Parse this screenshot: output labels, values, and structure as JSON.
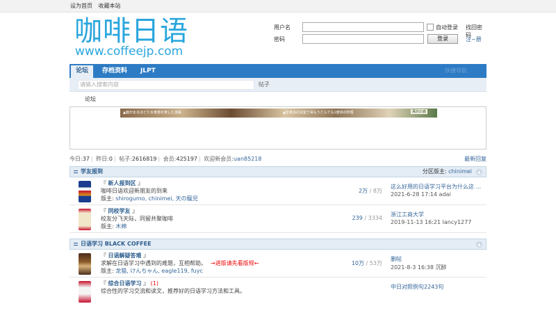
{
  "topbar": {
    "links": [
      "设为首页",
      "收藏本站"
    ]
  },
  "logo": {
    "cn": "咖啡日语",
    "en": "www.coffeejp.com"
  },
  "login": {
    "username_label": "用户名",
    "password_label": "密码",
    "auto_login_label": "自动登录",
    "find_password": "找回密码",
    "login_button": "登录",
    "register": "注~册"
  },
  "nav": {
    "tabs": [
      "论坛",
      "存档资料",
      "JLPT"
    ],
    "quick": "快捷导航"
  },
  "search": {
    "placeholder": "请输入搜索内容",
    "button": "帖子"
  },
  "breadcrumb": "论坛",
  "ad": {
    "left_text": "▲面が太るほどたる食感を楽しむ湯麺",
    "right_text": "▲全身浴の浴室で毒もうどんでも1度目の料理",
    "brand": "萬的の森"
  },
  "stats": {
    "today_label": "今日:",
    "today": "37",
    "yesterday_label": "昨日:",
    "yesterday": "0",
    "posts_label": "帖子:",
    "posts": "2616819",
    "members_label": "会员:",
    "members": "425197",
    "newest_label": "欢迎新会员:",
    "newest": "uan85218",
    "latest_reply": "最新回复"
  },
  "categories": [
    {
      "title": "学友报到",
      "moderator_label": "分区版主:",
      "moderator": "chinimei",
      "forums": [
        {
          "name": "新人报到区",
          "desc": "咖啡日语欢迎新朋友的到来",
          "mods_label": "版主:",
          "mods": "shirogumo, chinimei, 天の寵児",
          "threads": "2万",
          "posts": "8万",
          "last_post": "这么好用的日语学习平台为什么这 ...",
          "last_date": "2021-6-28 17:14 adai"
        },
        {
          "name": "同校学友",
          "desc": "校友分飞天际，同留共聚咖啡",
          "mods_label": "版主:",
          "mods": "木棉",
          "threads": "239",
          "posts": "3334",
          "last_post": "浙江工商大学",
          "last_date": "2019-11-13 16:21 lancy1277"
        }
      ]
    },
    {
      "title": "日语学习 BLACK COFFEE",
      "moderator_label": "",
      "moderator": "",
      "forums": [
        {
          "name": "日语解疑答难",
          "desc": "求解在日语学习中遇到的难题，互相帮助。",
          "hot": "→进版请先看版规←",
          "mods_label": "版主:",
          "mods": "龙猫, けんちゃん, eagle119, fuyc",
          "threads": "10万",
          "posts": "53万",
          "last_post": "删帖",
          "last_date": "2021-8-3 16:38 沉醉"
        },
        {
          "name": "综合日语学习",
          "badge": "(1)",
          "desc": "综合性的学习交流和读文，推荐好的日语学习方法和工具。",
          "mods_label": "",
          "mods": "",
          "threads": "",
          "posts": "",
          "last_post": "中日对照例句2243句",
          "last_date": ""
        }
      ]
    }
  ],
  "colors": {
    "nav": "#2d7bc4",
    "logo": "#2aa6dd",
    "catbar": "#e4ecf5",
    "hot": "#e00000"
  }
}
